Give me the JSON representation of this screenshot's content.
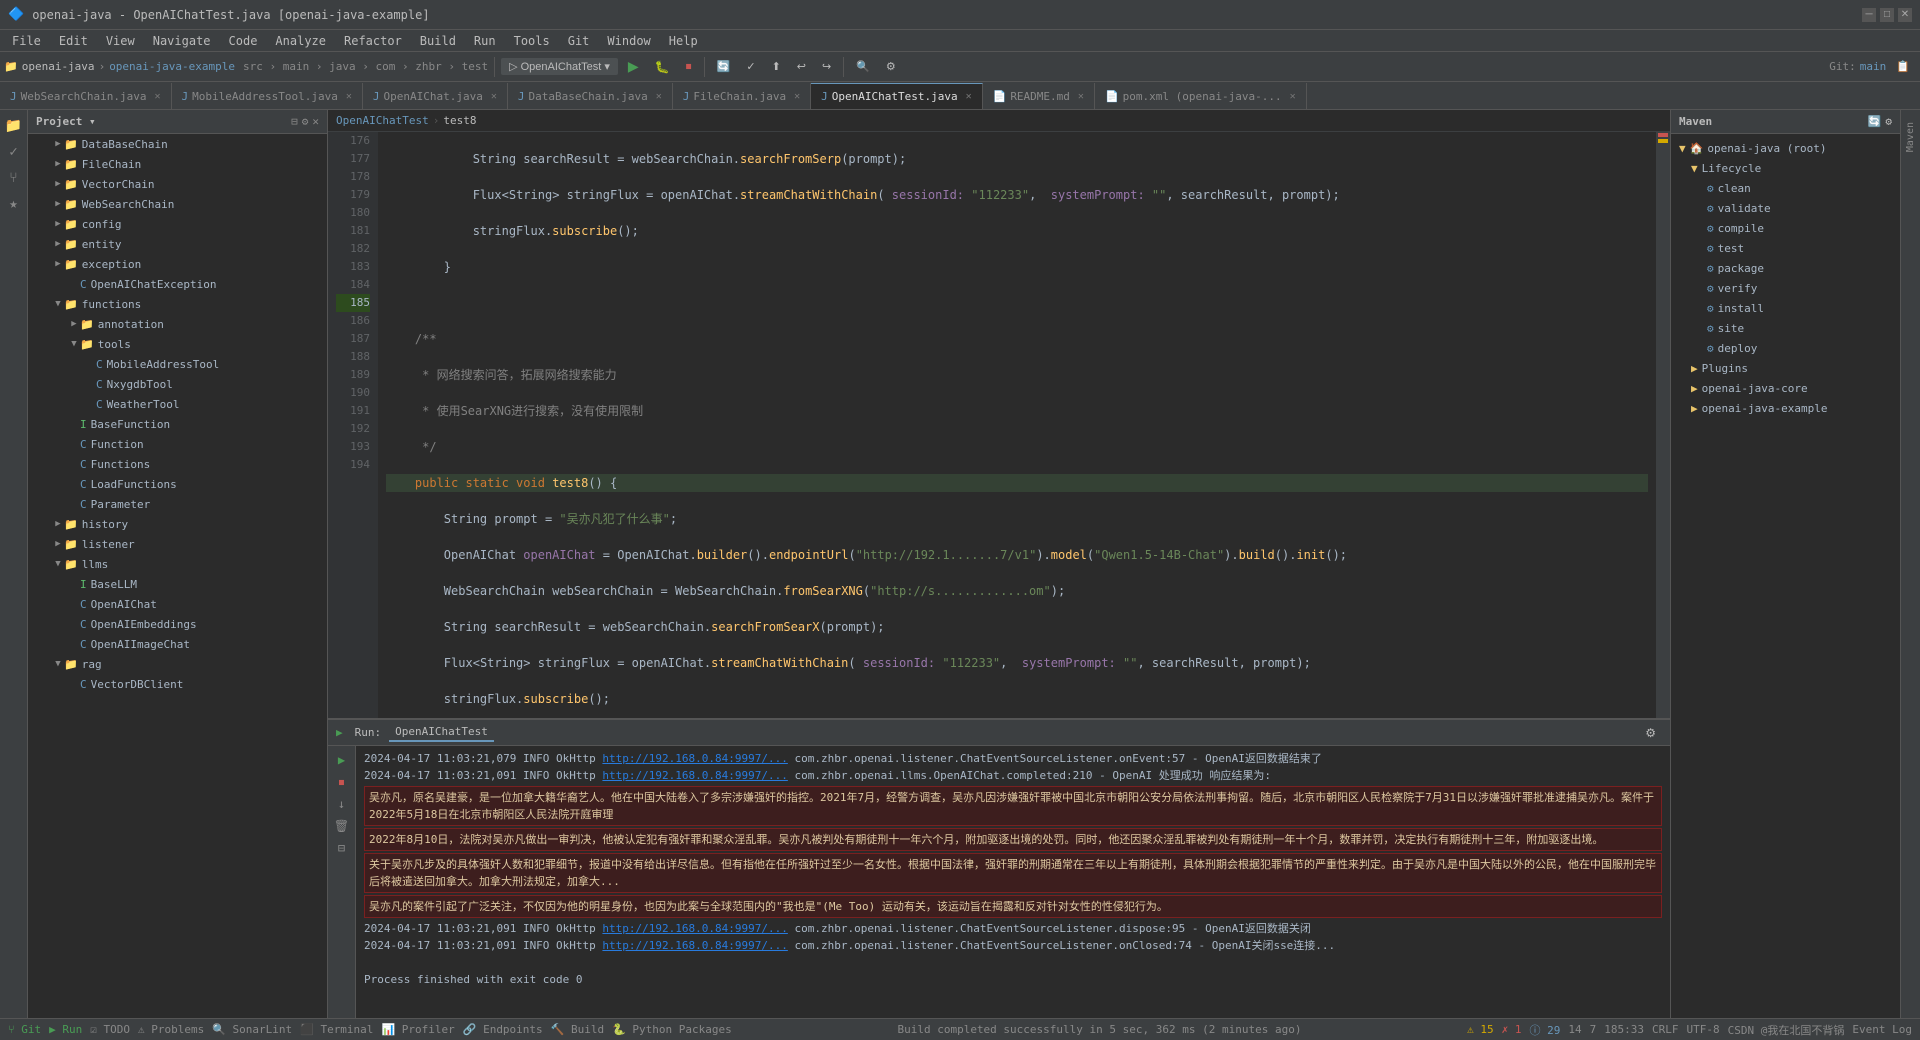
{
  "titleBar": {
    "title": "openai-java - OpenAIChatTest.java [openai-java-example]",
    "controls": [
      "minimize",
      "maximize",
      "close"
    ]
  },
  "menuBar": {
    "items": [
      "File",
      "Edit",
      "View",
      "Navigate",
      "Code",
      "Analyze",
      "Refactor",
      "Build",
      "Run",
      "Tools",
      "Git",
      "Window",
      "Help"
    ]
  },
  "toolbar": {
    "projectName": "openai-java",
    "moduleName": "openai-java-example",
    "srcPath": "src > main > java > com > zhbr > test",
    "runConfig": "OpenAIChatTest",
    "branch": "Git:"
  },
  "tabs": [
    {
      "label": "WebSearchChain.java",
      "active": false
    },
    {
      "label": "MobileAddressTool.java",
      "active": false
    },
    {
      "label": "OpenAIChat.java",
      "active": false
    },
    {
      "label": "DataBaseChain.java",
      "active": false
    },
    {
      "label": "FileChain.java",
      "active": false
    },
    {
      "label": "OpenAIChatTest.java",
      "active": true
    },
    {
      "label": "README.md",
      "active": false
    },
    {
      "label": "pom.xml (openai-java-...",
      "active": false
    }
  ],
  "breadcrumb": {
    "items": [
      "OpenAIChatTest",
      "test8"
    ]
  },
  "projectPanel": {
    "title": "Project",
    "tree": [
      {
        "indent": 0,
        "type": "folder",
        "label": "DataBaseChain",
        "expanded": false
      },
      {
        "indent": 0,
        "type": "folder",
        "label": "FileChain",
        "expanded": false
      },
      {
        "indent": 0,
        "type": "folder",
        "label": "VectorChain",
        "expanded": false
      },
      {
        "indent": 0,
        "type": "folder",
        "label": "WebSearchChain",
        "expanded": false
      },
      {
        "indent": 0,
        "type": "folder",
        "label": "config",
        "expanded": false
      },
      {
        "indent": 0,
        "type": "folder",
        "label": "entity",
        "expanded": false
      },
      {
        "indent": 0,
        "type": "folder",
        "label": "exception",
        "expanded": false
      },
      {
        "indent": 1,
        "type": "java",
        "label": "OpenAIChatException",
        "expanded": false
      },
      {
        "indent": 0,
        "type": "folder",
        "label": "functions",
        "expanded": true
      },
      {
        "indent": 1,
        "type": "folder",
        "label": "annotation",
        "expanded": false
      },
      {
        "indent": 1,
        "type": "folder",
        "label": "tools",
        "expanded": true
      },
      {
        "indent": 2,
        "type": "java",
        "label": "MobileAddressTool",
        "expanded": false
      },
      {
        "indent": 2,
        "type": "java",
        "label": "NxygdbTool",
        "expanded": false
      },
      {
        "indent": 2,
        "type": "java",
        "label": "WeatherTool",
        "expanded": false
      },
      {
        "indent": 1,
        "type": "interface",
        "label": "BaseFunction",
        "expanded": false
      },
      {
        "indent": 1,
        "type": "java",
        "label": "Function",
        "expanded": false
      },
      {
        "indent": 1,
        "type": "java",
        "label": "Functions",
        "expanded": false
      },
      {
        "indent": 1,
        "type": "java",
        "label": "LoadFunctions",
        "expanded": false
      },
      {
        "indent": 1,
        "type": "java",
        "label": "Parameter",
        "expanded": false
      },
      {
        "indent": 0,
        "type": "folder",
        "label": "history",
        "expanded": false
      },
      {
        "indent": 0,
        "type": "folder",
        "label": "listener",
        "expanded": false
      },
      {
        "indent": 0,
        "type": "folder",
        "label": "llms",
        "expanded": true
      },
      {
        "indent": 1,
        "type": "interface",
        "label": "BaseLLM",
        "expanded": false
      },
      {
        "indent": 1,
        "type": "java",
        "label": "OpenAIChat",
        "expanded": false
      },
      {
        "indent": 1,
        "type": "java",
        "label": "OpenAIEmbeddings",
        "expanded": false
      },
      {
        "indent": 1,
        "type": "java",
        "label": "OpenAIImageChat",
        "expanded": false
      },
      {
        "indent": 0,
        "type": "folder",
        "label": "rag",
        "expanded": true
      },
      {
        "indent": 1,
        "type": "java",
        "label": "VectorDBClient",
        "expanded": false
      }
    ]
  },
  "editor": {
    "lines": [
      {
        "num": 176,
        "code": "            String searchResult = webSearchChain.searchFromSerp(prompt);"
      },
      {
        "num": 177,
        "code": "            Flux<String> stringFlux = openAIChat.streamChatWithChain( sessionId: \"112233\",  systemPrompt: \"\", searchResult, prompt);"
      },
      {
        "num": 178,
        "code": "            stringFlux.subscribe();"
      },
      {
        "num": 179,
        "code": "        }"
      },
      {
        "num": 180,
        "code": ""
      },
      {
        "num": 181,
        "code": "    /**"
      },
      {
        "num": 182,
        "code": "     * 网络搜索问答，拓展网络搜索能力"
      },
      {
        "num": 183,
        "code": "     * 使用SearXNG进行搜索，没有使用限制"
      },
      {
        "num": 184,
        "code": "     */"
      },
      {
        "num": 185,
        "code": "    public static void test8() {"
      },
      {
        "num": 186,
        "code": "        String prompt = \"吴亦凡犯了什么事\";"
      },
      {
        "num": 187,
        "code": "        OpenAIChat openAIChat = OpenAIChat.builder().endpointUrl(\"http://192.1.......7/v1\").model(\"Qwen1.5-14B-Chat\").build().init();"
      },
      {
        "num": 188,
        "code": "        WebSearchChain webSearchChain = WebSearchChain.fromSearXNG(\"http://s.............om\");"
      },
      {
        "num": 189,
        "code": "        String searchResult = webSearchChain.searchFromSearX(prompt);"
      },
      {
        "num": 190,
        "code": "        Flux<String> stringFlux = openAIChat.streamChatWithChain( sessionId: \"112233\",  systemPrompt: \"\", searchResult, prompt);"
      },
      {
        "num": 191,
        "code": "        stringFlux.subscribe();"
      },
      {
        "num": 192,
        "code": "    }"
      },
      {
        "num": 193,
        "code": ""
      },
      {
        "num": 194,
        "code": ""
      }
    ]
  },
  "mavenPanel": {
    "title": "Maven",
    "tree": [
      {
        "indent": 0,
        "label": "openai-java (root)",
        "expanded": true
      },
      {
        "indent": 1,
        "label": "Lifecycle",
        "expanded": true
      },
      {
        "indent": 2,
        "label": "clean"
      },
      {
        "indent": 2,
        "label": "validate"
      },
      {
        "indent": 2,
        "label": "compile"
      },
      {
        "indent": 2,
        "label": "test"
      },
      {
        "indent": 2,
        "label": "package"
      },
      {
        "indent": 2,
        "label": "verify"
      },
      {
        "indent": 2,
        "label": "install"
      },
      {
        "indent": 2,
        "label": "site"
      },
      {
        "indent": 2,
        "label": "deploy"
      },
      {
        "indent": 1,
        "label": "Plugins",
        "expanded": false
      },
      {
        "indent": 1,
        "label": "openai-java-core",
        "expanded": false
      },
      {
        "indent": 1,
        "label": "openai-java-example",
        "expanded": false
      }
    ]
  },
  "consolePanel": {
    "runTab": "OpenAIChatTest",
    "lines": [
      {
        "type": "info",
        "text": "2024-04-17 11:03:21,079  INFO OkHttp ",
        "link": "http://192.168.0.84:9997/...",
        "rest": " com.zhbr.openai.listener.ChatEventSourceListener.onEvent:57 - OpenAI返回数据结束了"
      },
      {
        "type": "info",
        "text": "2024-04-17 11:03:21,091  INFO OkHttp ",
        "link": "http://192.168.0.84:9997/...",
        "rest": " com.zhbr.openai.llms.OpenAIChat.completed:210 - OpenAI 处理成功 响应结果为:"
      },
      {
        "type": "highlight",
        "text": "吴亦凡，原名吴建豪，是一位加拿大籍华裔艺人。他在中国大陆卷入了多宗涉嫌强奸的指控。2021年7月，经警方调查，吴亦凡因涉嫌强奸罪被中国北京市朝阳公安分局依法刑事拘留。随后，北京市朝阳区人民检察院于7月31日以涉嫌强奸罪批准逮捕吴亦凡。案件于2022年5月18日在北京市朝阳区人民法院开庭审理"
      },
      {
        "type": "highlight",
        "text": "2022年8月10日，法院对吴亦凡做出一审判决，他被认定犯有强奸罪和聚众淫乱罪。吴亦凡被判处有期徒刑十一年六个月，附加驱逐出境的处罚。同时，他还因聚众淫乱罪被判处有期徒刑一年十个月，数罪并罚，决定执行有期徒刑十三年，附加驱逐出境。"
      },
      {
        "type": "highlight",
        "text": "关于吴亦凡步及的具体强奸人数和犯罪细节，报道中没有给出详尽信息。但有指他在任所强奸过至少一名女性。根据中国法律，强奸罪的刑期通常在三年以上有期徒刑，具体刑期会根据犯罪情节的严重性来判定。由于吴亦凡是中国大陆以外的公民，他在中国服刑完毕后将被遣送回加拿大。加拿大刑法规定，加拿大..."
      },
      {
        "type": "highlight",
        "text": "吴亦凡的案件引起了广泛关注，不仅因为他的明星身份，也因为此案与全球范围内的\"我也是\"(Me Too) 运动有关，该运动旨在揭露和反对针对女性的性侵犯行为。"
      },
      {
        "type": "info",
        "text": "2024-04-17 11:03:21,091  INFO OkHttp ",
        "link": "http://192.168.0.84:9997/...",
        "rest": " com.zhbr.openai.listener.ChatEventSourceListener.dispose:95 - OpenAI返回数据关闭"
      },
      {
        "type": "info",
        "text": "2024-04-17 11:03:21,091  INFO OkHttp ",
        "link": "http://192.168.0.84:9997/...",
        "rest": " com.zhbr.openai.listener.ChatEventSourceListener.onClosed:74 - OpenAI关闭sse连接..."
      },
      {
        "type": "plain",
        "text": ""
      },
      {
        "type": "plain",
        "text": "Process finished with exit code 0"
      }
    ]
  },
  "statusBar": {
    "left": "Build completed successfully in 5 sec, 362 ms (2 minutes ago)",
    "warningCount": "⚠ 15",
    "errorCount": "✗ 1",
    "infoCount": "ⓘ 29",
    "hintCount": "14",
    "otherCount": "7",
    "position": "185:33",
    "encoding": "CRLF",
    "charset": "UTF-8",
    "username": "CSDN @我在北国不背锅",
    "git": "Git",
    "todo": "TODO",
    "problems": "Problems",
    "sonar": "SonarLint",
    "terminal": "Terminal",
    "profiler": "Profiler",
    "endpoints": "Endpoints",
    "build": "Build",
    "python": "Python Packages"
  }
}
